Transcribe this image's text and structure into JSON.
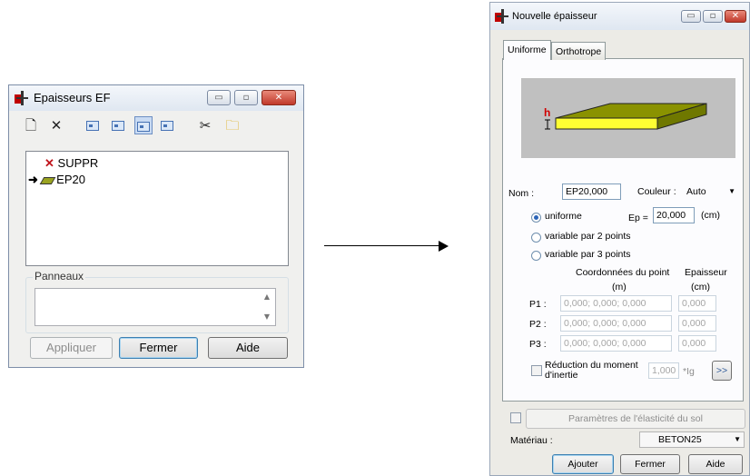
{
  "window1": {
    "title": "Epaisseurs EF",
    "controls": {
      "minimize": "▭",
      "maximize": "▫",
      "close": "✕"
    },
    "toolbar_icons": [
      "new-icon",
      "delete-icon",
      "view-small-icon",
      "view-list-icon",
      "view-detail-icon",
      "view-table-icon",
      "cut-icon",
      "open-folder-icon"
    ],
    "tree_items": [
      {
        "label": "SUPPR",
        "icon": "red-x-icon"
      },
      {
        "label": "EP20",
        "icon": "slab-icon",
        "current": true
      }
    ],
    "panneaux_label": "Panneaux",
    "buttons": {
      "apply": "Appliquer",
      "close": "Fermer",
      "help": "Aide"
    }
  },
  "window2": {
    "title": "Nouvelle épaisseur",
    "controls": {
      "minimize": "▭",
      "maximize": "▫",
      "close": "✕"
    },
    "tabs": [
      "Uniforme",
      "Orthotrope"
    ],
    "active_tab": "Uniforme",
    "preview": {
      "dimension_label": "h",
      "slab_color": "#ffff33",
      "background": "#c0c0c0"
    },
    "nom_label": "Nom :",
    "nom_value": "EP20,000",
    "couleur_label": "Couleur :",
    "couleur_value": "Auto",
    "options": [
      "uniforme",
      "variable par 2 points",
      "variable par 3 points"
    ],
    "selected_option": "uniforme",
    "ep_label": "Ep =",
    "ep_value": "20,000",
    "ep_unit": "(cm)",
    "coord_header": "Coordonnées du point",
    "coord_unit": "(m)",
    "epaisseur_header": "Epaisseur",
    "epaisseur_unit": "(cm)",
    "points": [
      {
        "label": "P1 :",
        "coords": "0,000; 0,000; 0,000",
        "thickness": "0,000"
      },
      {
        "label": "P2 :",
        "coords": "0,000; 0,000; 0,000",
        "thickness": "0,000"
      },
      {
        "label": "P3 :",
        "coords": "0,000; 0,000; 0,000",
        "thickness": "0,000"
      }
    ],
    "reduction_label_1": "Réduction du moment",
    "reduction_label_2": "d'inertie",
    "reduction_value": "1,000",
    "reduction_unit": "*Ig",
    "reduction_more": ">>",
    "sol_button": "Paramètres de l'élasticité du sol",
    "materiau_label": "Matériau :",
    "materiau_value": "BETON25",
    "buttons": {
      "add": "Ajouter",
      "close": "Fermer",
      "help": "Aide"
    }
  }
}
